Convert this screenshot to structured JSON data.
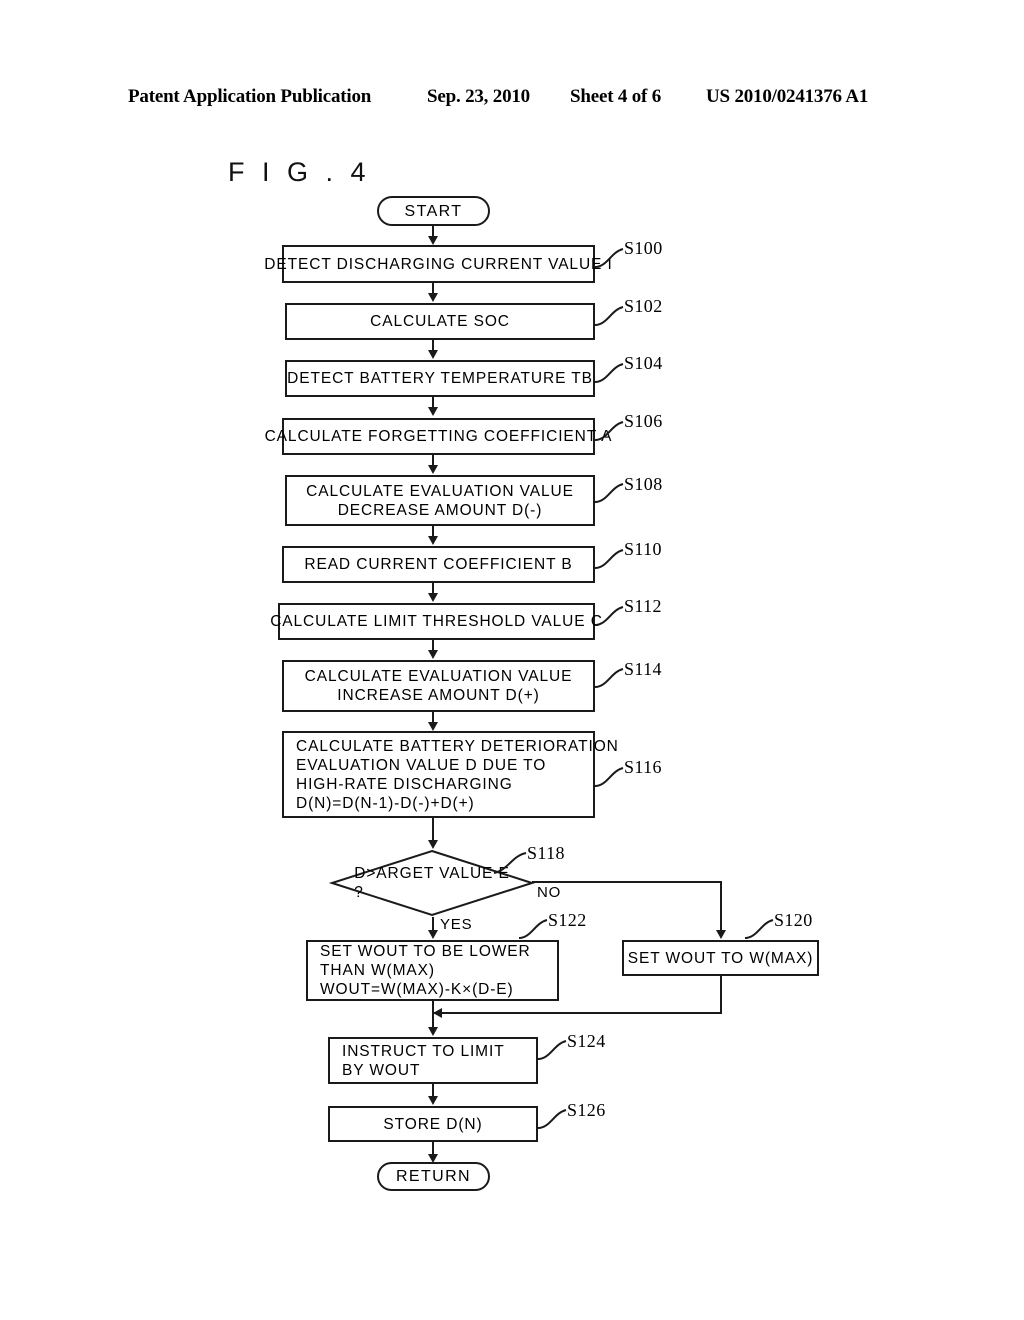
{
  "header": {
    "publication": "Patent Application Publication",
    "date": "Sep. 23, 2010",
    "sheet": "Sheet 4 of 6",
    "publication_number": "US 2010/0241376 A1"
  },
  "figure": {
    "title": "F I G .  4"
  },
  "flowchart": {
    "start_label": "START",
    "return_label": "RETURN",
    "branch_yes": "YES",
    "branch_no": "NO",
    "steps": [
      {
        "ref": "S100",
        "text": "DETECT DISCHARGING CURRENT VALUE I"
      },
      {
        "ref": "S102",
        "text": "CALCULATE SOC"
      },
      {
        "ref": "S104",
        "text": "DETECT BATTERY TEMPERATURE TB"
      },
      {
        "ref": "S106",
        "text": "CALCULATE FORGETTING COEFFICIENT A"
      },
      {
        "ref": "S108",
        "text": "CALCULATE EVALUATION VALUE\nDECREASE AMOUNT D(-)"
      },
      {
        "ref": "S110",
        "text": "READ CURRENT COEFFICIENT B"
      },
      {
        "ref": "S112",
        "text": "CALCULATE LIMIT THRESHOLD VALUE C"
      },
      {
        "ref": "S114",
        "text": "CALCULATE EVALUATION VALUE\nINCREASE AMOUNT D(+)"
      },
      {
        "ref": "S116",
        "text": "CALCULATE BATTERY DETERIORATION\nEVALUATION VALUE D DUE TO\nHIGH-RATE DISCHARGING\nD(N)=D(N-1)-D(-)+D(+)"
      },
      {
        "ref": "S118",
        "text": "D>ARGET VALUE E\n?"
      },
      {
        "ref": "S120",
        "text": "SET WOUT TO W(MAX)"
      },
      {
        "ref": "S122",
        "text": "SET WOUT TO BE LOWER\nTHAN W(MAX)\nWOUT=W(MAX)-K×(D-E)"
      },
      {
        "ref": "S124",
        "text": "INSTRUCT TO LIMIT\nBY WOUT"
      },
      {
        "ref": "S126",
        "text": "STORE D(N)"
      }
    ]
  },
  "colors": {
    "ink": "#1a1a1a",
    "paper": "#ffffff"
  }
}
